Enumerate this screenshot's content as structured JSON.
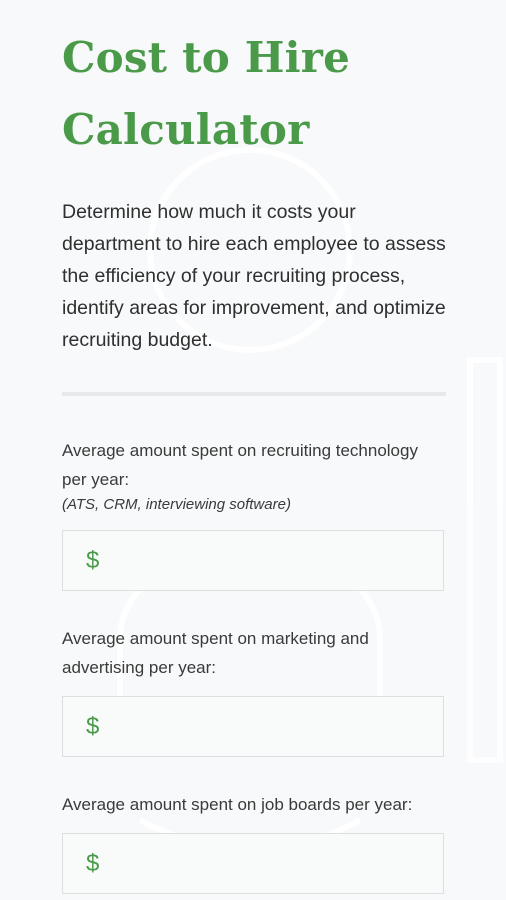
{
  "page": {
    "title": "Cost to Hire Calculator",
    "description": "Determine how much it costs your department to hire each employee to assess the efficiency of your recruiting process, identify areas for improvement, and optimize recruiting budget."
  },
  "fields": [
    {
      "label": "Average amount spent on recruiting technology per year:",
      "hint": "(ATS, CRM, interviewing software)",
      "currency_symbol": "$",
      "value": ""
    },
    {
      "label": "Average amount spent on marketing and advertising per year:",
      "currency_symbol": "$",
      "value": ""
    },
    {
      "label": "Average amount spent on job boards per year:",
      "currency_symbol": "$",
      "value": ""
    }
  ],
  "colors": {
    "accent": "#4a9a4a",
    "background": "#f7f9fa",
    "border": "#dcdfe1",
    "text": "#2f2f2f"
  }
}
